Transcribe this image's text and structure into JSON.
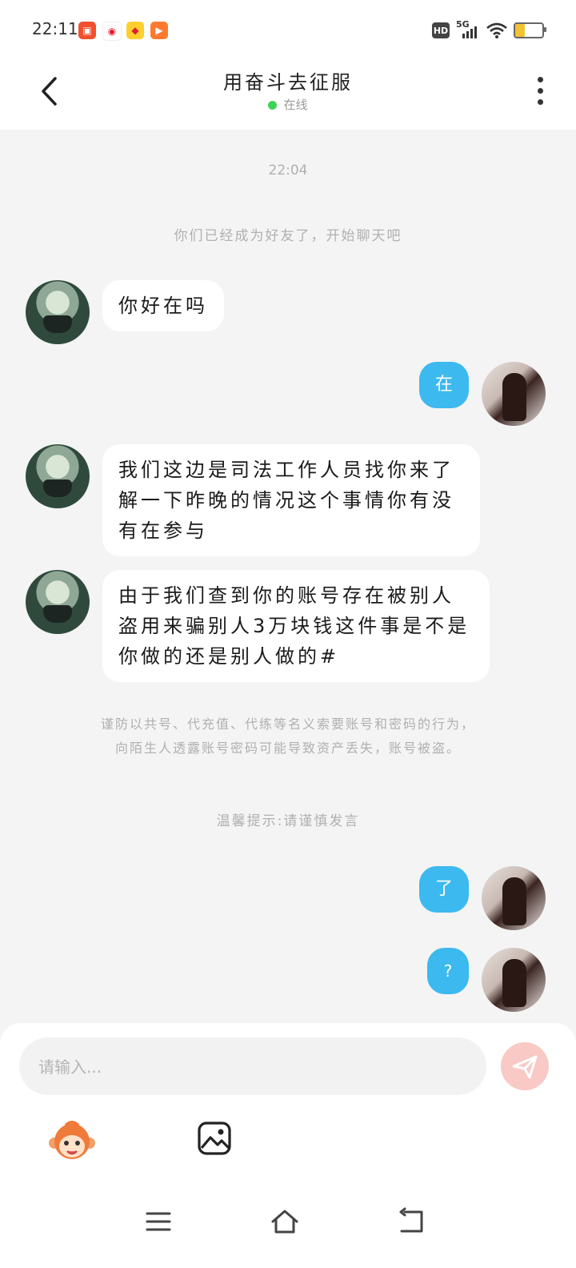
{
  "status_bar": {
    "time": "22:11",
    "app_icons": [
      "app-icon-red-square",
      "weibo-icon",
      "yellow-app-icon",
      "video-app-icon"
    ],
    "hd_label": "HD",
    "network_label": "5G",
    "battery_level": "36"
  },
  "header": {
    "title": "用奋斗去征服",
    "status": "在线"
  },
  "chat": {
    "timestamp": "22:04",
    "friend_notice": "你们已经成为好友了，开始聊天吧",
    "messages": [
      {
        "side": "left",
        "text": "你好在吗"
      },
      {
        "side": "right",
        "text": "在"
      },
      {
        "side": "left",
        "text": "我们这边是司法工作人员找你来了解一下昨晚的情况这个事情你有没有在参与"
      },
      {
        "side": "left",
        "text": "由于我们查到你的账号存在被别人盗用来骗别人3万块钱这件事是不是你做的还是别人做的#"
      },
      {
        "side": "right",
        "text": "了"
      },
      {
        "side": "right",
        "text": "?"
      }
    ],
    "warning_line1": "谨防以共号、代充值、代练等名义索要账号和密码的行为，",
    "warning_line2": "向陌生人透露账号密码可能导致资产丢失，账号被盗。",
    "tip": "温馨提示:请谨慎发言"
  },
  "input": {
    "placeholder": "请输入..."
  },
  "colors": {
    "accent_blue": "#3cb9ef",
    "online_green": "#3ed354",
    "send_button": "#f9c9c5",
    "background": "#f4f4f4"
  }
}
